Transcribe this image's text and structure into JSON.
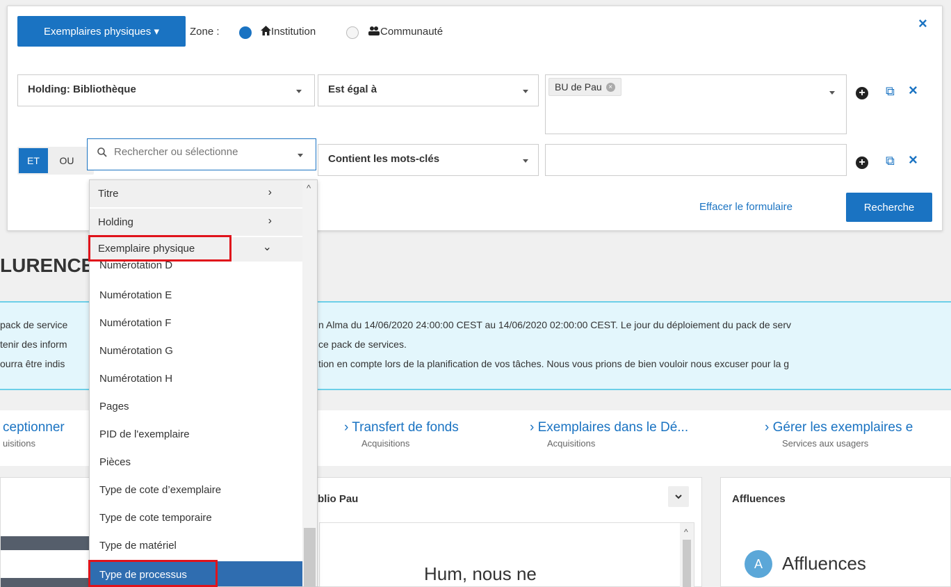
{
  "header": {
    "scope_button": "Exemplaires physiques ▾",
    "zone_label": "Zone :",
    "zone_options": [
      {
        "label": "Institution",
        "selected": true
      },
      {
        "label": "Communauté",
        "selected": false
      }
    ],
    "close_icon": "×"
  },
  "rows": [
    {
      "field": "Holding: Bibliothèque",
      "operator": "Est égal à",
      "value_tags": [
        "BU de Pau"
      ]
    },
    {
      "logic": {
        "and_label": "ET",
        "or_label": "OU"
      },
      "field_placeholder": "Rechercher ou sélectionne",
      "operator": "Contient les mots-clés",
      "value": ""
    }
  ],
  "row_icons": {
    "add": "+",
    "copy": "⧉",
    "delete": "×"
  },
  "actions": {
    "clear_label": "Effacer le formulaire",
    "search_label": "Recherche"
  },
  "dropdown": {
    "groups": [
      {
        "label": "Titre",
        "chevron": "›"
      },
      {
        "label": "Holding",
        "chevron": "›"
      },
      {
        "label": "Exemplaire physique",
        "chevron": "⌄"
      }
    ],
    "items": [
      "Numérotation D",
      "Numérotation E",
      "Numérotation F",
      "Numérotation G",
      "Numérotation H",
      "Pages",
      "PID de l'exemplaire",
      "Pièces",
      "Type de cote d’exemplaire",
      "Type de cote temporaire",
      "Type de matériel",
      "Type de processus"
    ],
    "selected_item": "Type de processus",
    "scroll_up": "^"
  },
  "background": {
    "page_title": "LURENCE",
    "notice_lines": [
      "pack de service",
      "tenir des inform",
      "ourra être indis",
      "n Alma du 14/06/2020 24:00:00 CEST au 14/06/2020 02:00:00 CEST. Le jour du déploiement du pack de serv",
      "ce pack de services.",
      "tion en compte lors de la planification de vos tâches. Nous vous prions de bien vouloir nous excuser pour la g"
    ],
    "quick_links": [
      {
        "title": "ceptionner",
        "subtitle": "uisitions"
      },
      {
        "title": "› Transfert de fonds",
        "subtitle": "Acquisitions"
      },
      {
        "title": "› Exemplaires dans le Dé...",
        "subtitle": "Acquisitions"
      },
      {
        "title": "› Gérer les exemplaires e",
        "subtitle": "Services aux usagers"
      }
    ],
    "widgets": [
      {
        "title": "blio Pau",
        "body": "Hum, nous ne"
      },
      {
        "title": "Affluences",
        "logo_text": "Affluences",
        "logo_letter": "A"
      }
    ]
  },
  "colors": {
    "primary": "#1a73c2",
    "highlight": "#e0131b",
    "selected_row": "#2f6db0",
    "notice_bg": "#e3f6fc"
  }
}
